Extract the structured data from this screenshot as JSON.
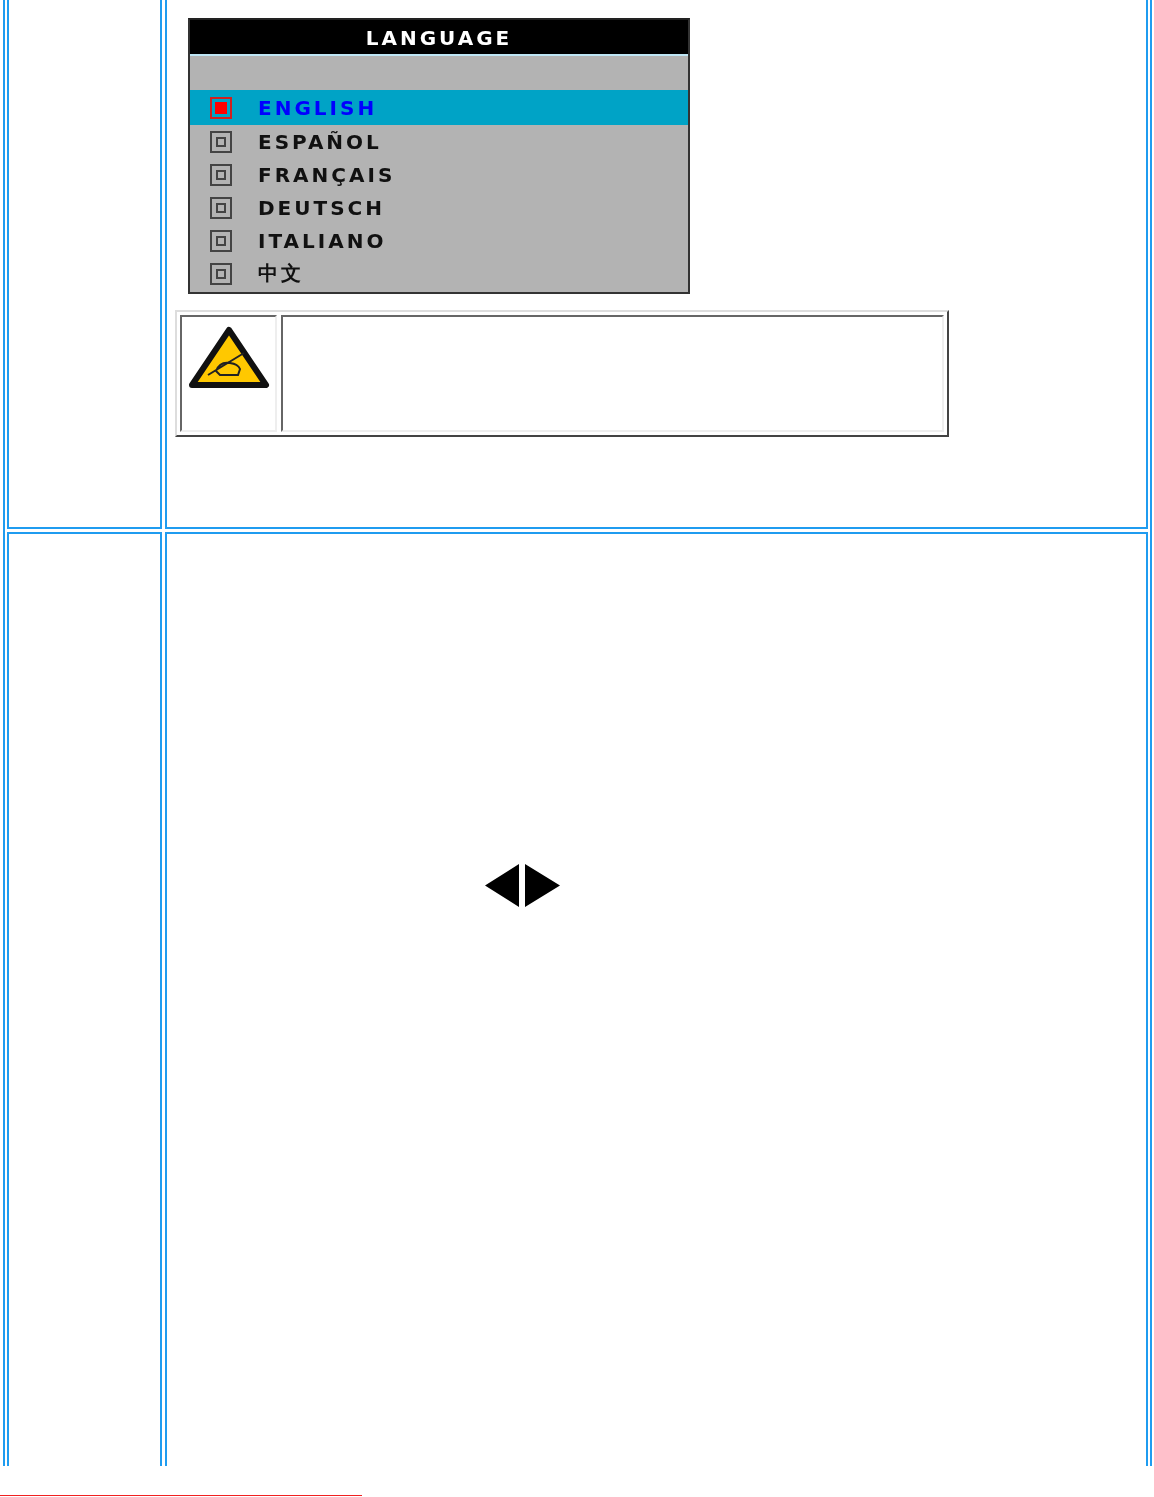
{
  "language_menu": {
    "title": "LANGUAGE",
    "items": [
      {
        "label": "ENGLISH",
        "selected": true
      },
      {
        "label": "ESPAÑOL",
        "selected": false
      },
      {
        "label": "FRANÇAIS",
        "selected": false
      },
      {
        "label": "DEUTSCH",
        "selected": false
      },
      {
        "label": "ITALIANO",
        "selected": false
      },
      {
        "label": "中文",
        "selected": false
      }
    ]
  }
}
